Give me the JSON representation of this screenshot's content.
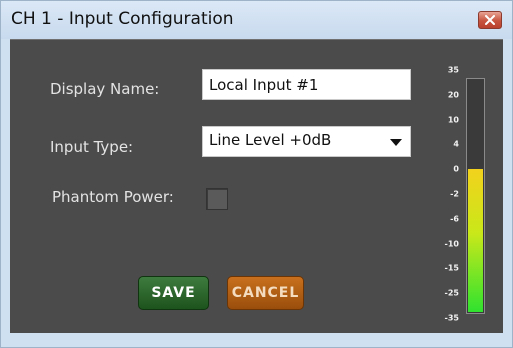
{
  "window": {
    "title": "CH 1 - Input Configuration"
  },
  "form": {
    "display_name_label": "Display Name:",
    "display_name_value": "Local Input #1",
    "input_type_label": "Input Type:",
    "input_type_value": "Line Level +0dB",
    "phantom_power_label": "Phantom Power:",
    "phantom_power_checked": false
  },
  "buttons": {
    "save_label": "SAVE",
    "cancel_label": "CANCEL",
    "save_color": "#2e6b2e",
    "cancel_color": "#b5611a"
  },
  "meter": {
    "scale_labels": [
      "35",
      "20",
      "10",
      "4",
      "0",
      "-2",
      "-6",
      "-10",
      "-15",
      "-25",
      "-35"
    ],
    "level_fraction": 0.62,
    "level_colors": [
      "#f2d21c",
      "#c9e81a",
      "#2fe22f"
    ]
  },
  "icons": {
    "close": "close-icon",
    "dropdown": "chevron-down-icon"
  }
}
